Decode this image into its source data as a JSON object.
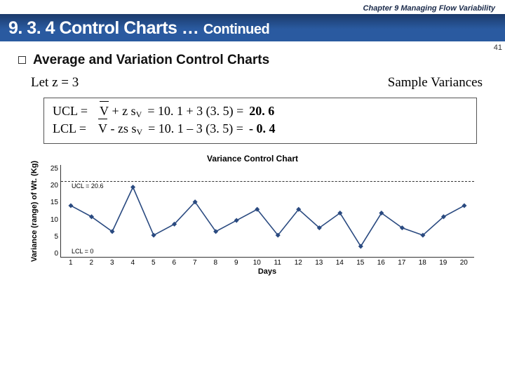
{
  "chapter": "Chapter 9  Managing Flow Variability",
  "title": {
    "section_num": "9. 3. 4 Control Charts …",
    "continued": "Continued"
  },
  "page_number": "41",
  "subheading": "Average and Variation Control Charts",
  "let_text": "Let z = 3",
  "sample_var_label": "Sample Variances",
  "equations": {
    "ucl_label": "UCL =",
    "ucl_lhs_sym": "V",
    "ucl_lhs_rest": "+ z s",
    "ucl_sub": "V",
    "ucl_rhs": "=  10. 1 + 3 (3. 5) =",
    "ucl_val": "20. 6",
    "lcl_label": "LCL =",
    "lcl_lhs_sym": "V",
    "lcl_lhs_rest": "- zs s",
    "lcl_sub": "V",
    "lcl_rhs": "=  10. 1 – 3 (3. 5) =",
    "lcl_val": "- 0. 4"
  },
  "chart_data": {
    "type": "line",
    "title": "Variance Control Chart",
    "xlabel": "Days",
    "ylabel": "Variance (range) of Wt. (Kg)",
    "ylim": [
      0,
      25
    ],
    "categories": [
      "1",
      "2",
      "3",
      "4",
      "5",
      "6",
      "7",
      "8",
      "9",
      "10",
      "11",
      "12",
      "13",
      "14",
      "15",
      "16",
      "17",
      "18",
      "19",
      "20"
    ],
    "values": [
      14,
      11,
      7,
      19,
      6,
      9,
      15,
      7,
      10,
      13,
      6,
      13,
      8,
      12,
      3,
      12,
      8,
      6,
      11,
      14
    ],
    "ucl": {
      "value": 20.6,
      "label": "UCL = 20.6"
    },
    "lcl": {
      "value": 0,
      "label": "LCL = 0"
    }
  }
}
